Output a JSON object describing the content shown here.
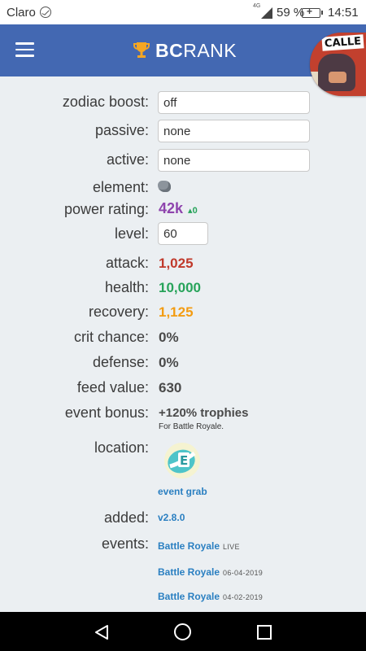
{
  "status_bar": {
    "carrier": "Claro",
    "network": "4G",
    "battery": "59 %",
    "time": "14:51",
    "icons": [
      "messenger-icon",
      "signal-icon",
      "battery-charging-icon"
    ]
  },
  "app_bar": {
    "brand_bold": "BC",
    "brand_rest": "RANK",
    "avatar_text": "CALLE",
    "icons": [
      "hamburger-icon",
      "trophy-icon"
    ]
  },
  "stats": {
    "zodiac_boost": {
      "label": "zodiac boost:",
      "value": "off"
    },
    "passive": {
      "label": "passive:",
      "value": "none"
    },
    "active": {
      "label": "active:",
      "value": "none"
    },
    "element": {
      "label": "element:",
      "icon": "rock-element-icon"
    },
    "power_rating": {
      "label": "power rating:",
      "value": "42k",
      "delta": "▴0"
    },
    "level": {
      "label": "level:",
      "value": "60"
    },
    "attack": {
      "label": "attack:",
      "value": "1,025"
    },
    "health": {
      "label": "health:",
      "value": "10,000"
    },
    "recovery": {
      "label": "recovery:",
      "value": "1,125"
    },
    "crit_chance": {
      "label": "crit chance:",
      "value": "0%"
    },
    "defense": {
      "label": "defense:",
      "value": "0%"
    },
    "feed_value": {
      "label": "feed value:",
      "value": "630"
    },
    "event_bonus": {
      "label": "event bonus:",
      "value": "+120% trophies",
      "note": "For Battle Royale."
    },
    "location": {
      "label": "location:",
      "value": "event grab",
      "icon": "egg-icon"
    },
    "added": {
      "label": "added:",
      "value": "v2.8.0"
    },
    "events": {
      "label": "events:",
      "items": [
        {
          "name": "Battle Royale",
          "tag": "LIVE"
        },
        {
          "name": "Battle Royale",
          "tag": "06-04-2019"
        },
        {
          "name": "Battle Royale",
          "tag": "04-02-2019"
        }
      ]
    }
  },
  "colors": {
    "app_bar": "#4368b2",
    "background": "#ebeff2",
    "power": "#8e44ad",
    "attack": "#c0392b",
    "health": "#27a35a",
    "recovery": "#f39c12",
    "link": "#2a7fc1"
  },
  "nav_bar": {
    "icons": [
      "back-icon",
      "home-icon",
      "recents-icon"
    ]
  }
}
